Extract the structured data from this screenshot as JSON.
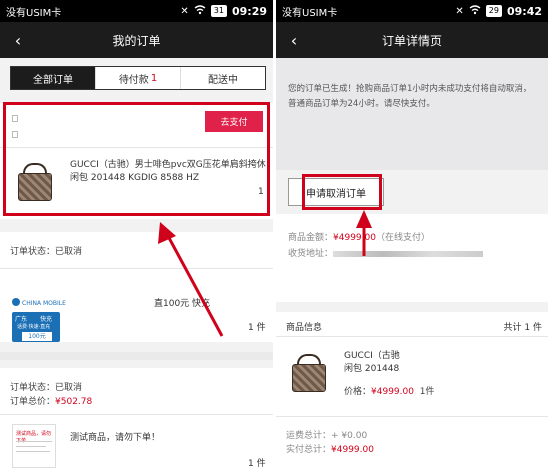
{
  "left": {
    "status_bar": {
      "carrier": "没有USIM卡",
      "time": "09:29",
      "battery": "31"
    },
    "nav": {
      "title": "我的订单"
    },
    "tabs": [
      {
        "label": "全部订单",
        "count": ""
      },
      {
        "label": "待付款",
        "count": "1"
      },
      {
        "label": "配送中",
        "count": ""
      }
    ],
    "order1": {
      "pay_button": "去支付",
      "product_title_line1": "GUCCI（古驰）男士啡色pvc双G压花单肩斜挎休",
      "product_title_line2": "闲包 201448 KGDIG 8588 HZ",
      "qty_hint": "1"
    },
    "order2": {
      "status": "订单状态：已取消",
      "product_title": "直100元 快充",
      "qty": "1 件",
      "logo": {
        "brand": "CHINA MOBILE",
        "left_text": "广东",
        "right_text": "快充",
        "sub_text": "话费·快速·直充",
        "amount": "100元"
      }
    },
    "order3": {
      "status": "订单状态：已取消",
      "total_label": "订单总价：",
      "total_value": "¥502.78",
      "product_title": "测试商品，请勿下单！",
      "qty": "1 件",
      "thumb_text": "测试商品，请勿下单"
    }
  },
  "right": {
    "status_bar": {
      "carrier": "没有USIM卡",
      "time": "09:42",
      "battery": "29"
    },
    "nav": {
      "title": "订单详情页"
    },
    "notice": "您的订单已生成！抢购商品订单1小时内未成功支付将自动取消，普通商品订单为24小时。请尽快支付。",
    "cancel_button": "申请取消订单",
    "amount_label": "商品金额：",
    "amount_value": "¥4999.00",
    "pay_method": "（在线支付）",
    "address_label": "收货地址：",
    "product_info_label": "商品信息",
    "total_count": "共计 1 件",
    "item": {
      "title_line1": "GUCCI（古驰",
      "title_line2": "闲包 201448",
      "price_label": "价格：",
      "price_value": "¥4999.00",
      "qty": "1件"
    },
    "freight_label": "运费总计：",
    "freight_value": "+ ¥0.00",
    "paid_label": "实付总计：",
    "paid_value": "¥4999.00"
  },
  "colors": {
    "accent_red": "#d0021b",
    "pay_button": "#e0224b",
    "nav_bg": "#1c1c1c",
    "mobile_blue": "#1a6fb5"
  }
}
